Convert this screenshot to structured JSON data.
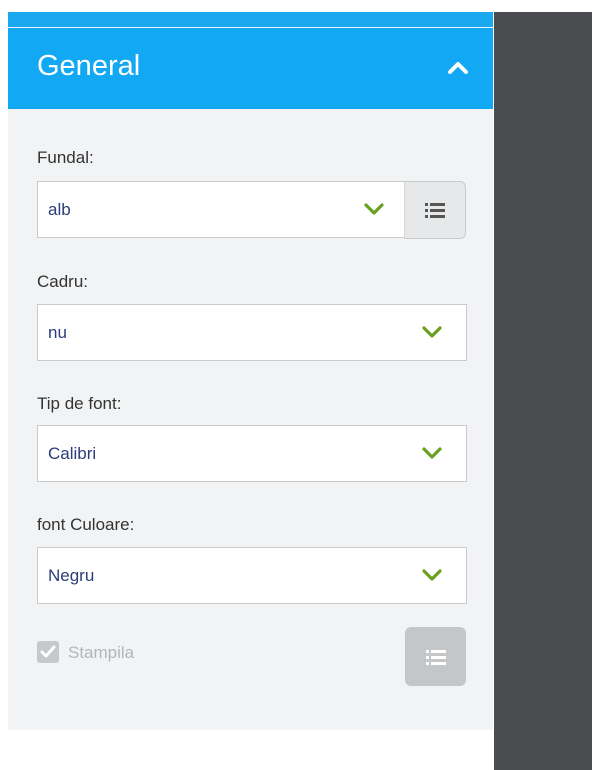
{
  "header": {
    "title": "General",
    "toggle_icon": "chevron-up-icon"
  },
  "fields": [
    {
      "label": "Fundal:",
      "value": "alb",
      "has_list_button": true
    },
    {
      "label": "Cadru:",
      "value": "nu",
      "has_list_button": false
    },
    {
      "label": "Tip de font:",
      "value": "Calibri",
      "has_list_button": false
    },
    {
      "label": "font Culoare:",
      "value": "Negru",
      "has_list_button": false
    }
  ],
  "stamp": {
    "label": "Stampila",
    "checked": true,
    "disabled": true
  },
  "colors": {
    "header_bg": "#12a8f3",
    "chevron_green": "#6aa01f",
    "value_text": "#2a3d78",
    "dark_pane": "#4a4c4f"
  }
}
